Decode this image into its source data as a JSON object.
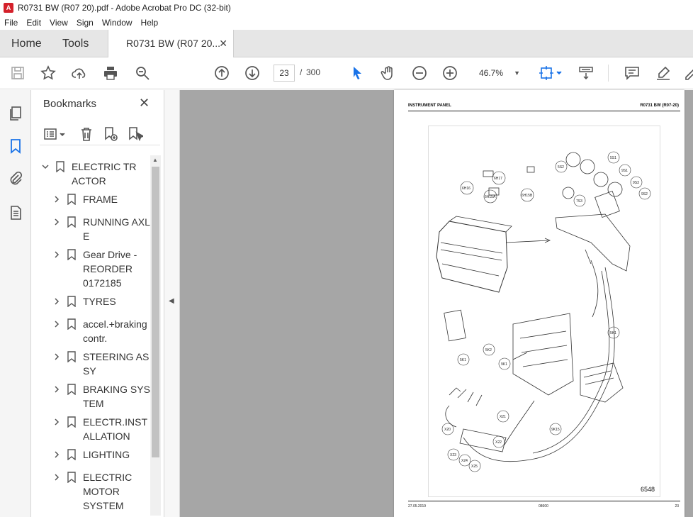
{
  "window": {
    "title": "R0731 BW (R07 20).pdf - Adobe Acrobat Pro DC (32-bit)"
  },
  "menu": {
    "items": [
      "File",
      "Edit",
      "View",
      "Sign",
      "Window",
      "Help"
    ]
  },
  "tabs": {
    "home": "Home",
    "tools": "Tools",
    "document": "R0731 BW (R07 20...",
    "close_glyph": "✕"
  },
  "toolbar": {
    "current_page": "23",
    "page_separator": "/",
    "total_pages": "300",
    "zoom": "46.7%"
  },
  "bookmarks": {
    "title": "Bookmarks",
    "close_glyph": "✕",
    "items": [
      {
        "label": "ELECTRIC TRACTOR",
        "expanded": true,
        "level": 0
      },
      {
        "label": "FRAME",
        "level": 1
      },
      {
        "label": "RUNNING AXLE",
        "level": 1
      },
      {
        "label": "Gear Drive - REORDER 0172185",
        "level": 1
      },
      {
        "label": "TYRES",
        "level": 1
      },
      {
        "label": "accel.+braking contr.",
        "level": 1
      },
      {
        "label": "STEERING ASSY",
        "level": 1
      },
      {
        "label": "BRAKING SYSTEM",
        "level": 1
      },
      {
        "label": "ELECTR.INSTALLATION",
        "level": 1
      },
      {
        "label": "LIGHTING",
        "level": 1
      },
      {
        "label": "ELECTRIC MOTOR SYSTEM",
        "level": 1
      }
    ]
  },
  "pdf_page": {
    "header_left": "INSTRUMENT PANEL",
    "header_right": "R0731 BW (R07-20)",
    "figure_number": "6548",
    "footer_left": "27.05.2019",
    "footer_mid": "08600",
    "footer_right": "23",
    "callouts": {
      "c1": "6H16",
      "c2": "6H17",
      "c3": "6H15A",
      "c4": "6H15B",
      "c5": "5S1",
      "c6": "5S2",
      "c7": "9S1",
      "c8": "9S3",
      "c9": "9S2",
      "c10": "7S3",
      "c11": "5K1",
      "c12": "5K2",
      "c13": "9K1",
      "c14": "5K1",
      "c15": "X21",
      "c16": "X20",
      "c17": "X22",
      "c18": "X23",
      "c19": "X24",
      "c20": "X25",
      "c21": "9K15"
    }
  },
  "colors": {
    "accent": "#1a73e8",
    "bookmark_flag": "#555555",
    "doc_bg": "#a6a6a6"
  }
}
